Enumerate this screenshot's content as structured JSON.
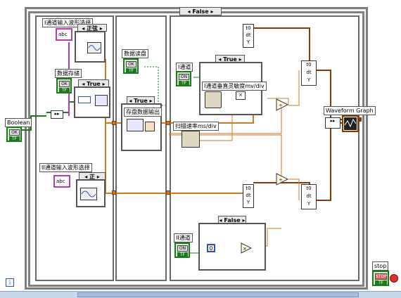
{
  "case_outer": {
    "selector": "False"
  },
  "left_boolean": {
    "label": "Boolean",
    "button": "OK",
    "tf": "TF"
  },
  "ch1": {
    "label": "I通道输入波形选择",
    "abc": "abc",
    "enum_value": "正弦"
  },
  "ch2": {
    "label": "II通道输入波形选择",
    "abc": "abc",
    "enum_value": "正"
  },
  "data_store": {
    "label": "数据存储",
    "button": "OK",
    "tf": "TF",
    "case": "True"
  },
  "data_read": {
    "label": "数据读盘",
    "button": "OK",
    "tf": "TF"
  },
  "true_case_2": {
    "case": "True",
    "label": "存盘数据输出"
  },
  "ch1_enable": {
    "label": "I通道",
    "button": "ON",
    "tf": "TF"
  },
  "vert_case": {
    "case": "True",
    "label": "I通道垂直灵敏度mv/div"
  },
  "scan_rate": {
    "label": "扫描速率ms/div"
  },
  "ch2_enable": {
    "label": "II通道",
    "button": "ON",
    "tf": "TF"
  },
  "false_case": {
    "case": "False",
    "const": "0"
  },
  "waveform_graph": {
    "label": "Waveform Graph"
  },
  "stop": {
    "label": "stop",
    "button": "STOP",
    "tf": "TF"
  },
  "bundle_labels": {
    "t0": "t0",
    "dt": "dt",
    "y": "Y"
  },
  "iter_label": "i",
  "colors": {
    "orange_wire": "#d07a20",
    "brown_wire": "#8a3a00",
    "blue_wire": "#3050c0",
    "green_wire": "#1c7a1c",
    "pink_wire": "#b13fb1"
  }
}
